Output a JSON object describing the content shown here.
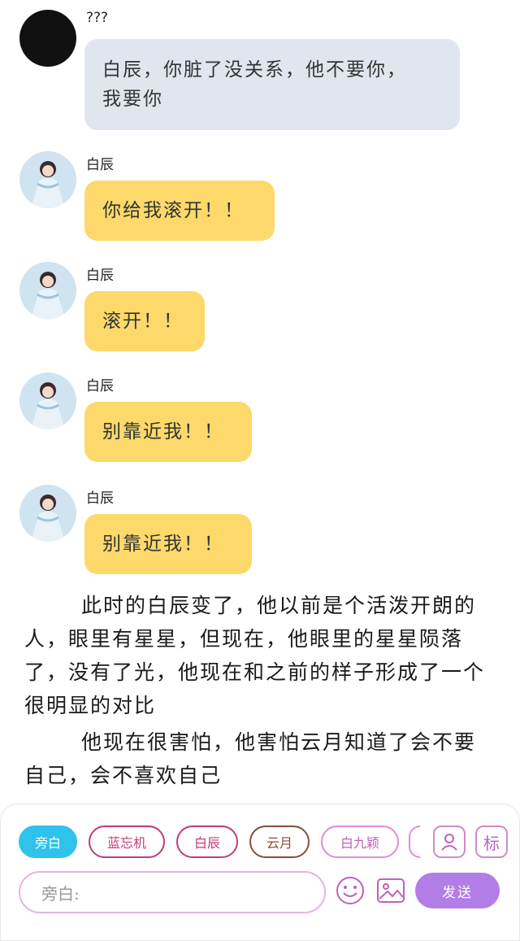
{
  "messages": [
    {
      "sender": "???",
      "text": "白辰，你脏了没关系，他不要你，\n我要你",
      "style": "grey",
      "avatar": "black"
    },
    {
      "sender": "白辰",
      "text": "你给我滚开！！",
      "style": "yellow",
      "avatar": "photo"
    },
    {
      "sender": "白辰",
      "text": "滚开！！",
      "style": "yellow",
      "avatar": "photo"
    },
    {
      "sender": "白辰",
      "text": "别靠近我！！",
      "style": "yellow",
      "avatar": "photo"
    },
    {
      "sender": "白辰",
      "text": "别靠近我！！",
      "style": "yellow",
      "avatar": "photo"
    }
  ],
  "narration": [
    "此时的白辰变了，他以前是个活泼开朗的人，眼里有星星，但现在，他眼里的星星陨落了，没有了光，他现在和之前的样子形成了一个很明显的对比",
    "他现在很害怕，他害怕云月知道了会不要自己，会不喜欢自己"
  ],
  "bottom_bar": {
    "characters": [
      "旁白",
      "蓝忘机",
      "白辰",
      "云月",
      "白九颖"
    ],
    "selected": "旁白",
    "input_placeholder": "旁白:",
    "send_label": "发送",
    "tag_label": "标"
  },
  "colors": {
    "grey_bubble": "#e1e6ee",
    "yellow_bubble": "#fcd96a",
    "active_chip": "#2fc2ea",
    "send_button": "#b27de6"
  }
}
